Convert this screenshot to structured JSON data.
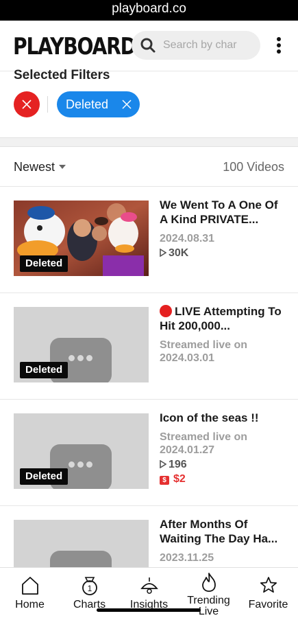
{
  "status_bar": {
    "url": "playboard.co"
  },
  "header": {
    "logo": "PLAYBOARD",
    "search_placeholder": "Search by char",
    "search_icon": "search-icon",
    "menu_icon": "more-vertical-icon"
  },
  "filters": {
    "title": "Selected Filters",
    "clear_icon": "close-icon",
    "chips": [
      {
        "label": "Deleted"
      }
    ]
  },
  "sort": {
    "selected": "Newest",
    "count": "100 Videos"
  },
  "videos": [
    {
      "title": "We Went To A One Of A Kind PRIVATE...",
      "date": "2024.08.31",
      "views": "30K",
      "badge": "Deleted",
      "thumbnail": "photo"
    },
    {
      "title": "LIVE Attempting To Hit 200,000...",
      "live_icon": "red-circle-icon",
      "date": "Streamed live on 2024.03.01",
      "badge": "Deleted",
      "thumbnail": "placeholder"
    },
    {
      "title": "Icon of the seas !!",
      "date": "Streamed live on 2024.01.27",
      "views": "196",
      "revenue": "$2",
      "badge": "Deleted",
      "thumbnail": "placeholder"
    },
    {
      "title": "After Months Of Waiting The Day Ha...",
      "date": "2023.11.25",
      "thumbnail": "placeholder"
    }
  ],
  "nav": [
    {
      "label": "Home",
      "icon": "home-icon"
    },
    {
      "label": "Charts",
      "icon": "medal-icon"
    },
    {
      "label": "Insights",
      "icon": "lamp-icon"
    },
    {
      "label": "Trending Live",
      "icon": "flame-icon"
    },
    {
      "label": "Favorite",
      "icon": "star-icon"
    }
  ],
  "colors": {
    "accent_blue": "#1a87ea",
    "alert_red": "#e52222",
    "badge_black": "#0a0a0a"
  }
}
